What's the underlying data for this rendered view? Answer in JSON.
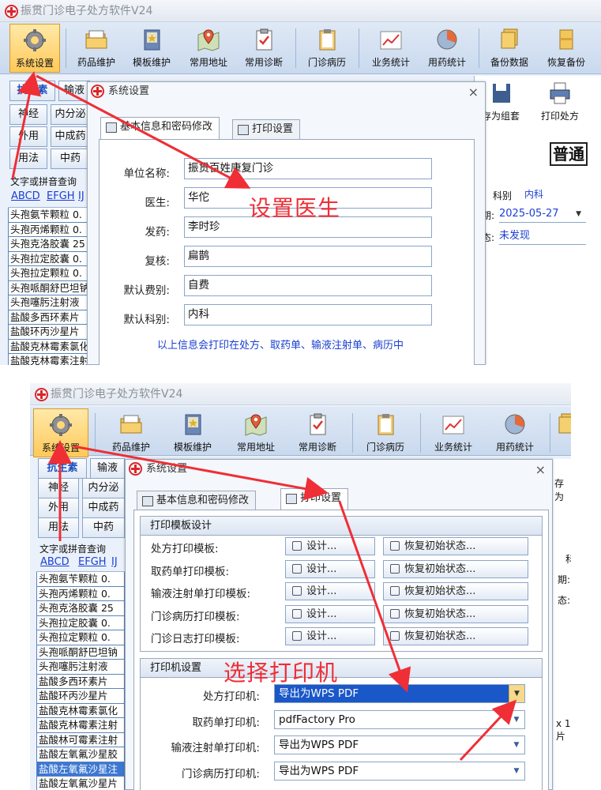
{
  "app": {
    "title": "振贯门诊电子处方软件V24"
  },
  "toolbar": {
    "items": [
      {
        "label": "系统设置",
        "icon": "gear-icon"
      },
      {
        "label": "药品维护",
        "icon": "folder-icon"
      },
      {
        "label": "模板维护",
        "icon": "book-icon"
      },
      {
        "label": "常用地址",
        "icon": "map-icon"
      },
      {
        "label": "常用诊断",
        "icon": "clipboard-check-icon"
      },
      {
        "label": "门诊病历",
        "icon": "clipboard-icon"
      },
      {
        "label": "业务统计",
        "icon": "line-chart-icon"
      },
      {
        "label": "用药统计",
        "icon": "pie-chart-icon"
      },
      {
        "label": "备份数据",
        "icon": "stack-icon"
      },
      {
        "label": "恢复备份",
        "icon": "box-icon"
      }
    ],
    "extra": {
      "save_group": "存为组套",
      "print_rx": "打印处方",
      "save_group_short": "存为"
    }
  },
  "left": {
    "row1": [
      "抗生素",
      "输液"
    ],
    "row2": [
      "神经",
      "内分泌"
    ],
    "row3": [
      "外用",
      "中成药"
    ],
    "row4": [
      "用法",
      "中药"
    ],
    "search_label": "文字或拼音查询",
    "alpha": [
      "ABCD",
      "EFGH",
      "IJ"
    ],
    "drugs1": [
      "头孢氨苄颗粒 0.",
      "头孢丙烯颗粒 0.",
      "头孢克洛胶囊 25",
      "头孢拉定胶囊 0.",
      "头孢拉定颗粒 0.",
      "头孢哌酮舒巴坦钠",
      "头孢噻肟注射液",
      "盐酸多西环素片",
      "盐酸环丙沙星片",
      "盐酸克林霉素氯化",
      "盐酸克林霉素注射"
    ],
    "drugs2": [
      "头孢氨苄颗粒 0.",
      "头孢丙烯颗粒 0.",
      "头孢克洛胶囊 25",
      "头孢拉定胶囊 0.",
      "头孢拉定颗粒 0.",
      "头孢哌酮舒巴坦钠",
      "头孢噻肟注射液",
      "盐酸多西环素片",
      "盐酸环丙沙星片",
      "盐酸克林霉素氯化",
      "盐酸克林霉素注射",
      "盐酸林可霉素注射",
      "盐酸左氧氟沙星胶",
      "盐酸左氧氟沙星注",
      "盐酸左氧氟沙星片",
      "氧氟沙星片 0.1g",
      "氧氟沙星注射液"
    ]
  },
  "rx": {
    "badge": "普通",
    "dept_label": "科别",
    "dept_value": "内科",
    "date_label": "期:",
    "date_value": "2025-05-27",
    "status_label": "态:",
    "status_value": "未发现",
    "right_label_1": "科",
    "right_label_2": "期:",
    "right_label_3": "态:",
    "right_label_4": "x 1片"
  },
  "dialog": {
    "title": "系统设置",
    "close": "×",
    "tab_basic": "基本信息和密码修改",
    "tab_print": "打印设置"
  },
  "basic_form": {
    "fields": [
      {
        "label": "单位名称:",
        "value": "振贯百姓康复门诊"
      },
      {
        "label": "医生:",
        "value": "华佗"
      },
      {
        "label": "发药:",
        "value": "李时珍"
      },
      {
        "label": "复核:",
        "value": "扁鹊"
      },
      {
        "label": "默认费别:",
        "value": "自费"
      },
      {
        "label": "默认科别:",
        "value": "内科"
      }
    ],
    "note": "以上信息会打印在处方、取药单、输液注射单、病历中"
  },
  "print_form": {
    "template_header": "打印模板设计",
    "templates": [
      "处方打印模板:",
      "取药单打印模板:",
      "输液注射单打印模板:",
      "门诊病历打印模板:",
      "门诊日志打印模板:"
    ],
    "design_btn": "设计...",
    "reset_btn": "恢复初始状态...",
    "printer_header": "打印机设置",
    "printers": [
      {
        "label": "处方打印机:",
        "value": "导出为WPS PDF"
      },
      {
        "label": "取药单打印机:",
        "value": "pdfFactory Pro"
      },
      {
        "label": "输液注射单打印机:",
        "value": "导出为WPS PDF"
      },
      {
        "label": "门诊病历打印机:",
        "value": "导出为WPS PDF"
      }
    ]
  },
  "annotations": {
    "set_doctor": "设置医生",
    "select_printer": "选择打印机",
    "color": "#ef2e36"
  }
}
